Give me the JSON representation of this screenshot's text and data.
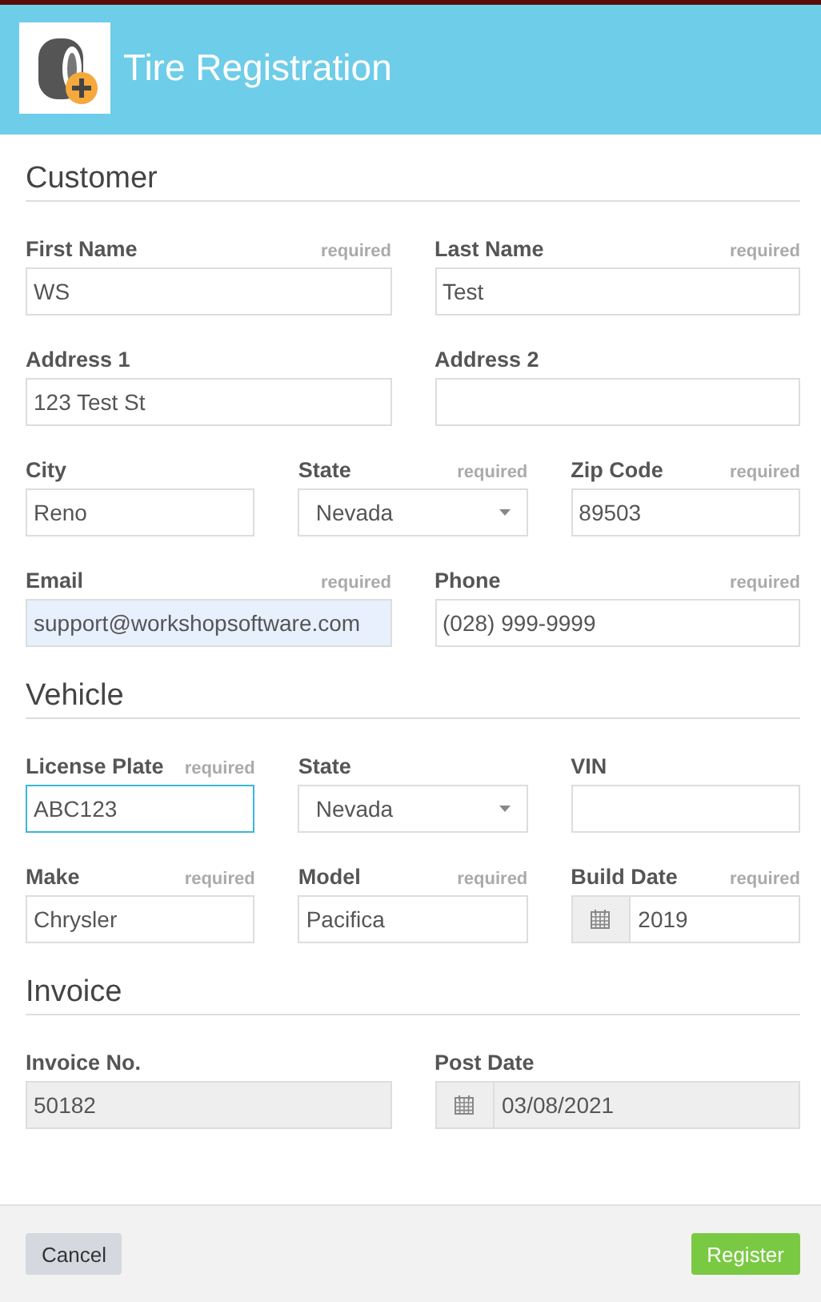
{
  "header": {
    "title": "Tire Registration"
  },
  "sections": [
    {
      "title": "Customer",
      "rows": [
        {
          "fields": [
            {
              "label": "First Name",
              "hint": "required",
              "kind": "text",
              "value": "WS",
              "focused": false,
              "autofilled": false,
              "disabled": false
            },
            {
              "label": "Last Name",
              "hint": "required",
              "kind": "text",
              "value": "Test",
              "focused": false,
              "autofilled": false,
              "disabled": false
            }
          ]
        },
        {
          "fields": [
            {
              "label": "Address 1",
              "kind": "text",
              "value": "123 Test St",
              "focused": false,
              "autofilled": false,
              "disabled": false
            },
            {
              "label": "Address 2",
              "kind": "text",
              "focused": false,
              "autofilled": false,
              "disabled": false
            }
          ]
        },
        {
          "fields": [
            {
              "label": "City",
              "kind": "text",
              "value": "Reno",
              "focused": false,
              "autofilled": false,
              "disabled": false
            },
            {
              "label": "State",
              "hint": "required",
              "kind": "select",
              "value": "Nevada",
              "focused": false,
              "autofilled": false,
              "disabled": false
            },
            {
              "label": "Zip Code",
              "hint": "required",
              "kind": "text",
              "value": "89503",
              "focused": false,
              "autofilled": false,
              "disabled": false
            }
          ]
        },
        {
          "fields": [
            {
              "label": "Email",
              "hint": "required",
              "kind": "text",
              "value": "support@workshopsoftware.com",
              "focused": false,
              "autofilled": true,
              "disabled": false
            },
            {
              "label": "Phone",
              "hint": "required",
              "kind": "text",
              "value": "(028) 999-9999",
              "focused": false,
              "autofilled": false,
              "disabled": false
            }
          ]
        }
      ]
    },
    {
      "title": "Vehicle",
      "rows": [
        {
          "fields": [
            {
              "label": "License Plate",
              "hint": "required",
              "kind": "text",
              "value": "ABC123",
              "focused": true,
              "autofilled": false,
              "disabled": false
            },
            {
              "label": "State",
              "kind": "select",
              "value": "Nevada",
              "focused": false,
              "autofilled": false,
              "disabled": false
            },
            {
              "label": "VIN",
              "kind": "text",
              "focused": false,
              "autofilled": false,
              "disabled": false
            }
          ]
        },
        {
          "fields": [
            {
              "label": "Make",
              "hint": "required",
              "kind": "text",
              "value": "Chrysler",
              "focused": false,
              "autofilled": false,
              "disabled": false
            },
            {
              "label": "Model",
              "hint": "required",
              "kind": "text",
              "value": "Pacifica",
              "focused": false,
              "autofilled": false,
              "disabled": false
            },
            {
              "label": "Build Date",
              "hint": "required",
              "kind": "date",
              "value": "2019",
              "focused": false,
              "autofilled": false,
              "disabled": false
            }
          ]
        }
      ]
    },
    {
      "title": "Invoice",
      "rows": [
        {
          "fields": [
            {
              "label": "Invoice No.",
              "kind": "text",
              "value": "50182",
              "focused": false,
              "autofilled": false,
              "disabled": true
            },
            {
              "label": "Post Date",
              "kind": "date",
              "value": "03/08/2021",
              "focused": false,
              "autofilled": false,
              "disabled": true
            }
          ]
        }
      ]
    }
  ],
  "footer": {
    "cancel": "Cancel",
    "submit": "Register"
  }
}
